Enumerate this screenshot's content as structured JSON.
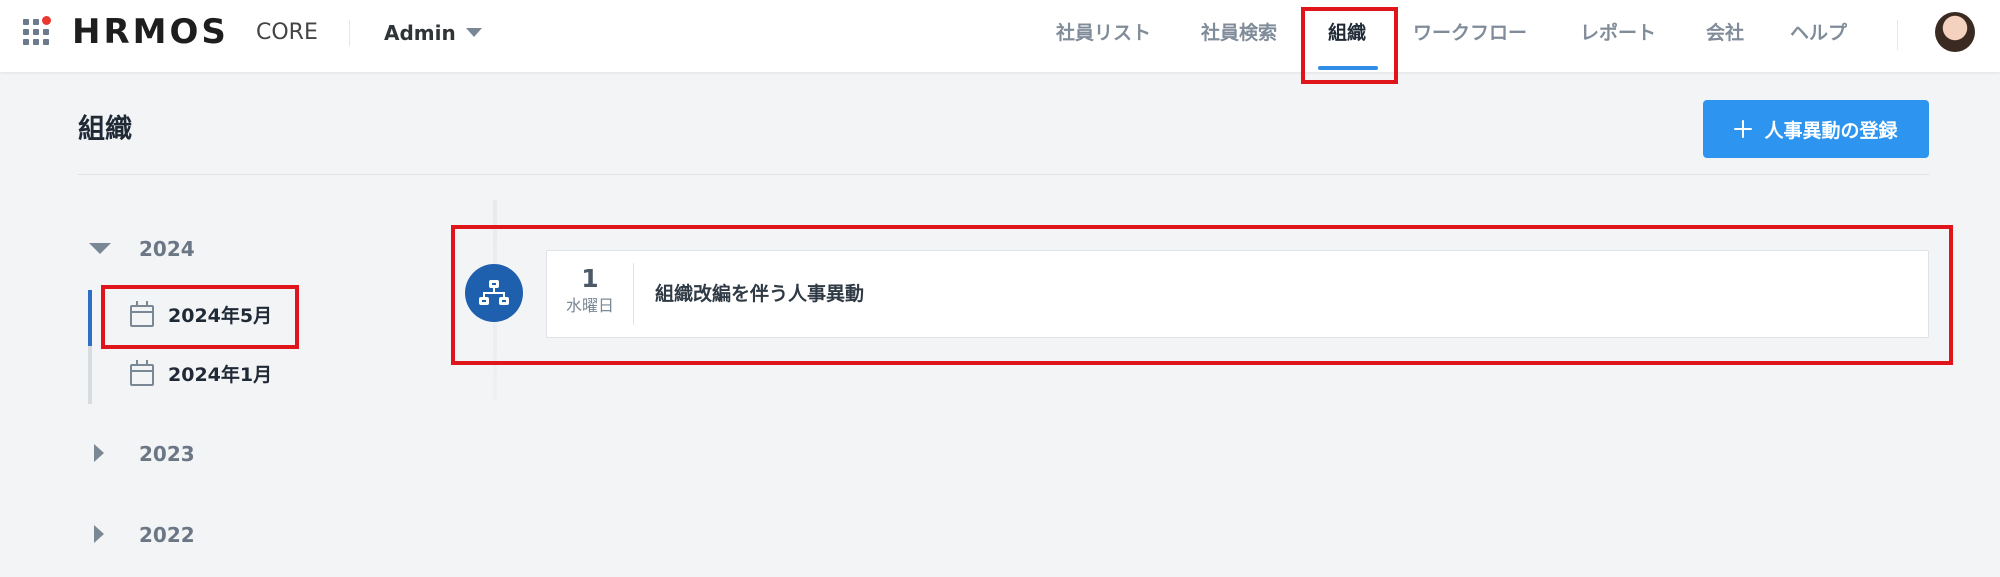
{
  "header": {
    "logo_text": "HRMOS",
    "logo_sub": "CORE",
    "role_label": "Admin",
    "nav": [
      {
        "label": "社員リスト",
        "active": false
      },
      {
        "label": "社員検索",
        "active": false
      },
      {
        "label": "組織",
        "active": true
      },
      {
        "label": "ワークフロー",
        "active": false
      },
      {
        "label": "レポート",
        "active": false
      },
      {
        "label": "会社",
        "active": false
      },
      {
        "label": "ヘルプ",
        "active": false
      }
    ]
  },
  "page": {
    "title": "組織",
    "register_button_label": "人事異動の登録"
  },
  "tree": {
    "years": [
      {
        "label": "2024",
        "expanded": true,
        "months": [
          {
            "label": "2024年5月",
            "selected": true
          },
          {
            "label": "2024年1月",
            "selected": false
          }
        ]
      },
      {
        "label": "2023",
        "expanded": false
      },
      {
        "label": "2022",
        "expanded": false
      }
    ]
  },
  "events": [
    {
      "day": "1",
      "weekday": "水曜日",
      "title": "組織改編を伴う人事異動",
      "icon": "org-chart-icon"
    }
  ],
  "colors": {
    "accent": "#2d95f0",
    "nav_underline": "#2e8de6",
    "node": "#1e5fae",
    "highlight": "#e0141b"
  }
}
